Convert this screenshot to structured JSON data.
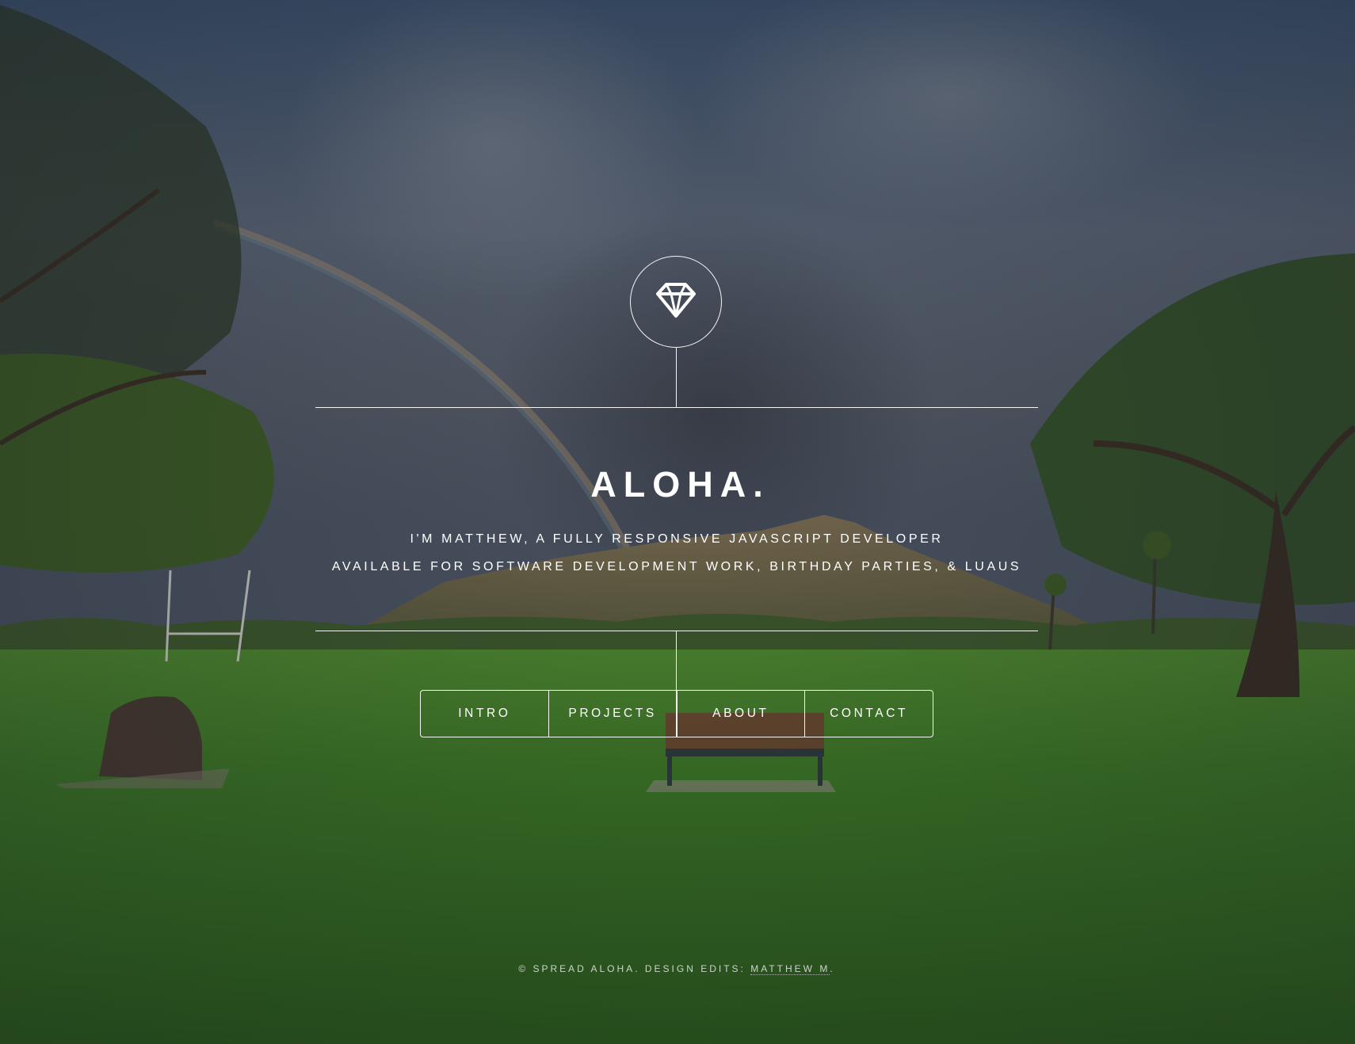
{
  "header": {
    "icon": "diamond-icon",
    "title": "ALOHA.",
    "tagline_1": "I'M MATTHEW, A FULLY RESPONSIVE JAVASCRIPT DEVELOPER",
    "tagline_2": "AVAILABLE FOR SOFTWARE DEVELOPMENT WORK, BIRTHDAY PARTIES, & LUAUS"
  },
  "nav": {
    "items": [
      {
        "label": "INTRO"
      },
      {
        "label": "PROJECTS"
      },
      {
        "label": "ABOUT"
      },
      {
        "label": "CONTACT"
      }
    ]
  },
  "footer": {
    "text": "© SPREAD ALOHA. DESIGN EDITS: ",
    "link_label": "MATTHEW M",
    "suffix": "."
  },
  "colors": {
    "text": "#ffffff",
    "sky": "#4a5566",
    "grass": "#3f7a2a"
  }
}
